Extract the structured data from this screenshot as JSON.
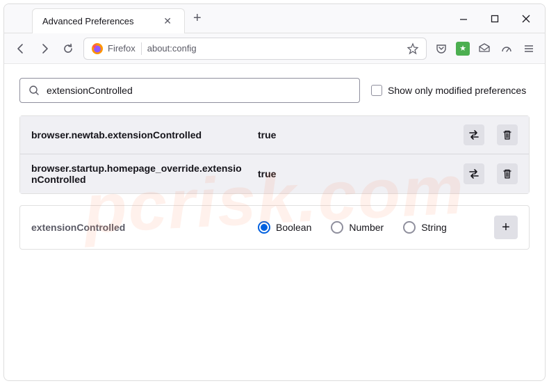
{
  "titlebar": {
    "tab_title": "Advanced Preferences"
  },
  "toolbar": {
    "identity_label": "Firefox",
    "url": "about:config"
  },
  "search": {
    "value": "extensionControlled",
    "checkbox_label": "Show only modified preferences"
  },
  "prefs": [
    {
      "name": "browser.newtab.extensionControlled",
      "value": "true"
    },
    {
      "name": "browser.startup.homepage_override.extensionControlled",
      "value": "true"
    }
  ],
  "new_pref": {
    "name": "extensionControlled",
    "types": [
      "Boolean",
      "Number",
      "String"
    ],
    "selected": "Boolean"
  },
  "watermark": "pcrisk.com"
}
